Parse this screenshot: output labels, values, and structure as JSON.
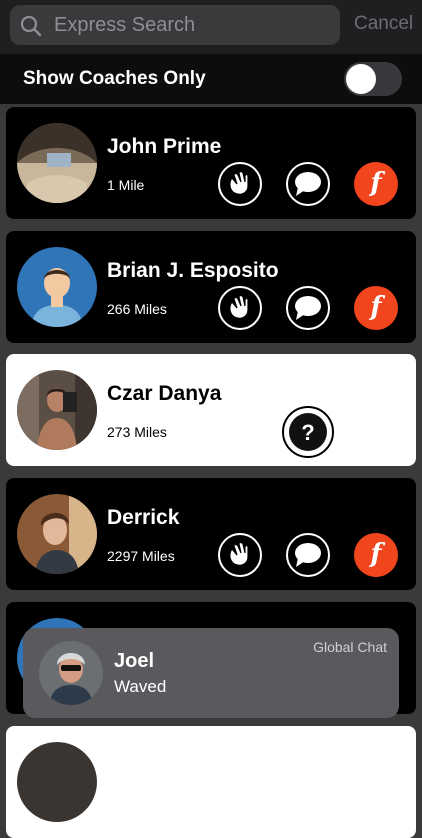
{
  "search": {
    "placeholder": "Express Search",
    "cancel_label": "Cancel"
  },
  "filter": {
    "label": "Show Coaches Only",
    "toggle_on": false
  },
  "people": [
    {
      "name": "John Prime",
      "distance": "1 Mile"
    },
    {
      "name": "Brian J. Esposito",
      "distance": "266 Miles"
    },
    {
      "name": "Czar Danya",
      "distance": "273 Miles"
    },
    {
      "name": "Derrick",
      "distance": "2297 Miles"
    }
  ],
  "notification": {
    "name": "Joel",
    "message": "Waved",
    "source": "Global Chat"
  },
  "colors": {
    "accent": "#f1451d",
    "card_dark": "#000000",
    "card_light": "#ffffff"
  }
}
